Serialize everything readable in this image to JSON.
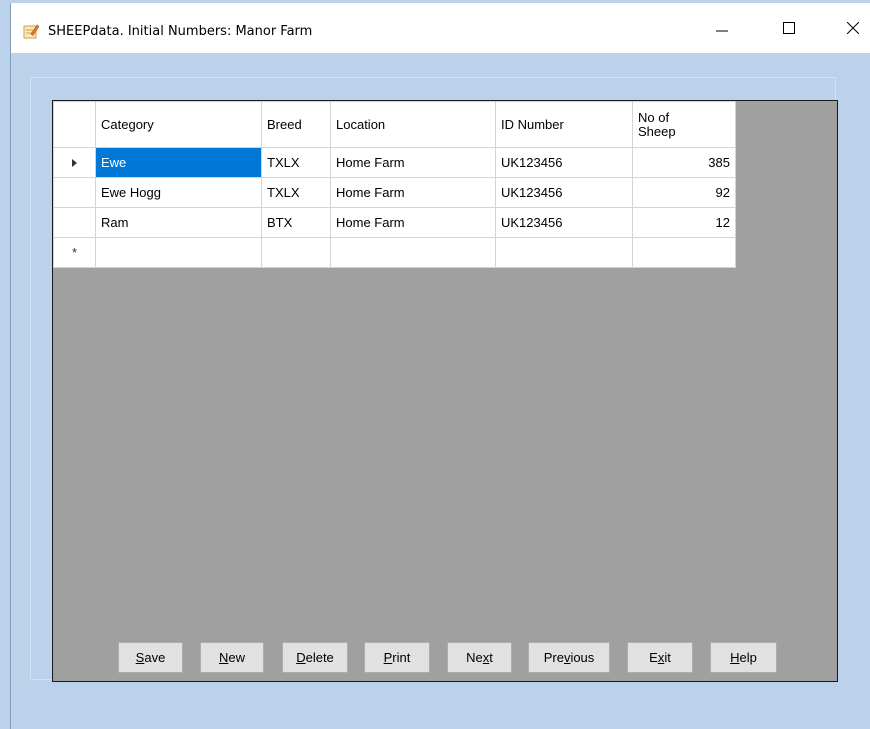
{
  "window": {
    "title": "SHEEPdata. Initial Numbers: Manor Farm",
    "icon": "notepad-pencil-icon",
    "minimize_glyph": "—",
    "maximize_glyph": "☐",
    "close_glyph": "✕"
  },
  "grid": {
    "columns": [
      {
        "label": "Category"
      },
      {
        "label": "Breed"
      },
      {
        "label": "Location"
      },
      {
        "label": "ID Number"
      },
      {
        "label": "No of Sheep"
      }
    ],
    "rows": [
      {
        "category": "Ewe",
        "breed": "TXLX",
        "location": "Home Farm",
        "id_number": "UK123456",
        "no_of_sheep": "385"
      },
      {
        "category": "Ewe Hogg",
        "breed": "TXLX",
        "location": "Home Farm",
        "id_number": "UK123456",
        "no_of_sheep": "92"
      },
      {
        "category": "Ram",
        "breed": "BTX",
        "location": "Home Farm",
        "id_number": "UK123456",
        "no_of_sheep": "12"
      }
    ],
    "current_row_marker": "current-row-arrow-icon",
    "new_row_marker": "*",
    "selection_color": "#0078d7"
  },
  "buttons": [
    {
      "label": "Save",
      "mnemonic": "S"
    },
    {
      "label": "New",
      "mnemonic": "N"
    },
    {
      "label": "Delete",
      "mnemonic": "D"
    },
    {
      "label": "Print",
      "mnemonic": "P"
    },
    {
      "label": "Next",
      "mnemonic": "x"
    },
    {
      "label": "Previous",
      "mnemonic": "v"
    },
    {
      "label": "Exit",
      "mnemonic": "x"
    },
    {
      "label": "Help",
      "mnemonic": "H"
    }
  ]
}
